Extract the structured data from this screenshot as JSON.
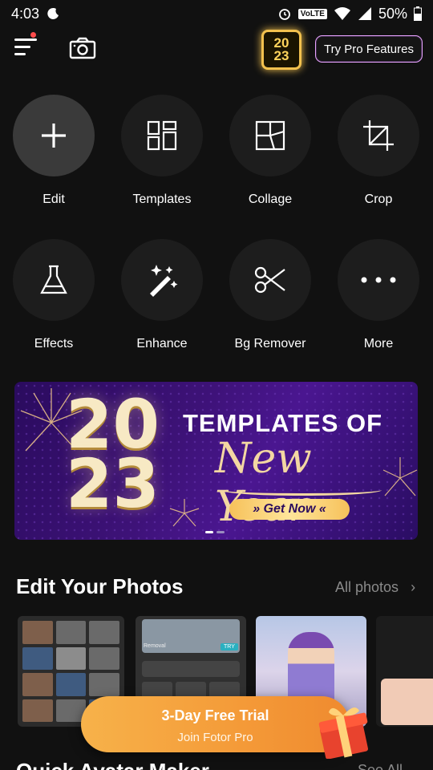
{
  "status_bar": {
    "time": "4:03",
    "volte": "VoLTE",
    "battery": "50%"
  },
  "header": {
    "pro_button": "Try Pro Features",
    "badge_line1": "20",
    "badge_line2": "23"
  },
  "tools": [
    {
      "label": "Edit"
    },
    {
      "label": "Templates"
    },
    {
      "label": "Collage"
    },
    {
      "label": "Crop"
    },
    {
      "label": "Effects"
    },
    {
      "label": "Enhance"
    },
    {
      "label": "Bg Remover"
    },
    {
      "label": "More"
    }
  ],
  "banner": {
    "year_top": "20",
    "year_bottom": "23",
    "title": "TEMPLATES OF",
    "script": "New Year",
    "cta": "Get Now",
    "active_page": 1,
    "pages": 2
  },
  "edit_section": {
    "title": "Edit Your Photos",
    "link": "All photos"
  },
  "thumb2": {
    "caption": "Removal",
    "try": "TRY"
  },
  "trial": {
    "line1": "3-Day Free Trial",
    "line2": "Join Fotor Pro"
  },
  "next_section": {
    "title": "Quick Avatar Maker",
    "link": "See All"
  }
}
